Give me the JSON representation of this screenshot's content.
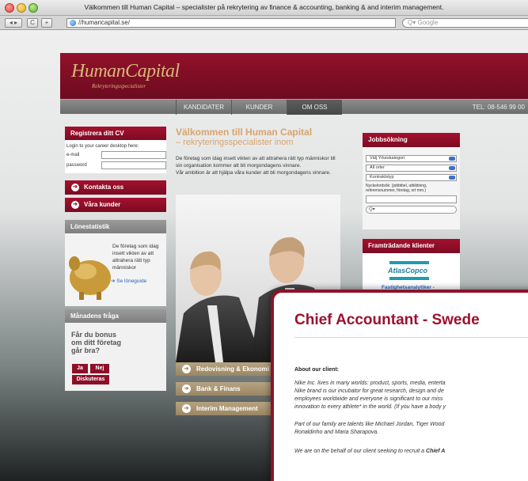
{
  "browser": {
    "title": "Välkommen till Human Capital – specialister på rekrytering av finance & accounting, banking & and interim management.",
    "url": "//humancapital.se/",
    "search_placeholder": "Google",
    "back_icon": "back-forward-arrows",
    "reload_icon": "reload-icon",
    "add_icon": "plus-icon"
  },
  "site": {
    "logo": "HumanCapital",
    "tagline": "Rekryteringsspecialister",
    "nav": [
      "KANDIDATER",
      "KUNDER",
      "OM OSS"
    ],
    "nav_active": "OM OSS",
    "phone": "TEL: 08-546 99 00"
  },
  "left": {
    "register_title": "Registrera ditt CV",
    "login_text": "Login to your career desktop here:",
    "email_label": "e-mail",
    "password_label": "password",
    "contact_button": "Kontakta oss",
    "customers_button": "Våra kunder",
    "salary_title": "Lönestatistik",
    "salary_text": "De företag som idag insett vikten av att attrahera rätt typ människor",
    "salary_link": "Se löneguide",
    "question_title": "Månadens fråga",
    "question_text": "Får du bonus om ditt företag går bra?",
    "yes_button": "Ja",
    "no_button": "Nej",
    "discuss_button": "Diskuteras"
  },
  "center": {
    "welcome_title": "Välkommen till Human Capital",
    "welcome_subtitle": "– rekryteringsspecialister inom",
    "paragraph1": "De företag som idag insett vikten av att attrahera rätt typ människor till sin organisation kommer att bli morgondagens vinnare.",
    "paragraph2": "Vår ambition är att hjälpa våra kunder att bli morgondagens vinnare.",
    "menu": [
      "Redovisning & Ekonomi",
      "Bank & Finans",
      "Interim Management"
    ]
  },
  "right": {
    "job_title": "Jobbsökning",
    "selects": [
      "Välj Yrkeskategori",
      "All orter",
      "Kontraktstyp"
    ],
    "keyword_label": "Nyckelordsök: (jobbtitel, utbildning, referensnummer, företag, ort mm.)",
    "clients_title": "Framträdande klienter",
    "client_logo": "AtlasCopco",
    "client_caption": "Fastighetsanalytiker -"
  },
  "modal": {
    "title": "Chief Accountant - Swede",
    "about_label": "About our client:",
    "lines1": [
      "Nike Inc. lives in many worlds: product, sports, media, enterta",
      "Nike brand is  our incubator for great research, design and de",
      "employees worldwide and everyone is significant to our miss",
      "innovation to every athlete* in the world. (If you have a body y"
    ],
    "lines2": [
      "Part of our family are talents like Michael Jordan, Tiger Wood",
      "Ronaldinho and Maria Sharapova."
    ],
    "line3": "We are on the behalf of our client seeking to recruit a ",
    "line3_bold": "Chief A"
  }
}
